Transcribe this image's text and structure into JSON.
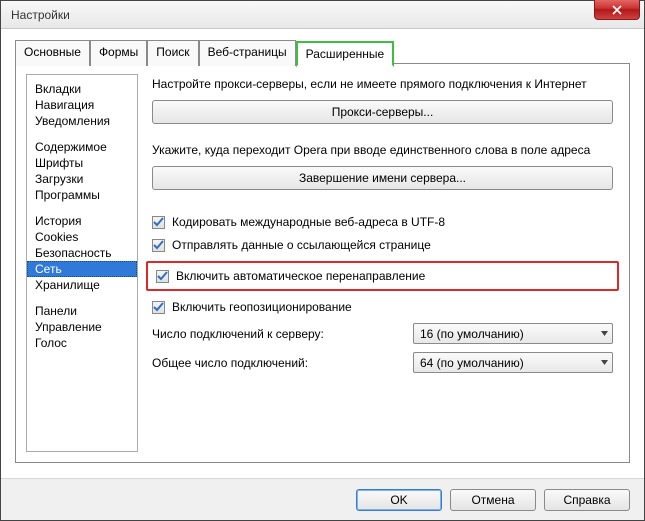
{
  "window": {
    "title": "Настройки"
  },
  "tabs": [
    "Основные",
    "Формы",
    "Поиск",
    "Веб-страницы",
    "Расширенные"
  ],
  "activeTabIndex": 4,
  "sidebar": {
    "groups": [
      [
        "Вкладки",
        "Навигация",
        "Уведомления"
      ],
      [
        "Содержимое",
        "Шрифты",
        "Загрузки",
        "Программы"
      ],
      [
        "История",
        "Cookies",
        "Безопасность",
        "Сеть",
        "Хранилище"
      ],
      [
        "Панели",
        "Управление",
        "Голос"
      ]
    ],
    "selected": "Сеть"
  },
  "main": {
    "proxy_text": "Настройте прокси-серверы, если не имеете прямого подключения к Интернет",
    "proxy_btn": "Прокси-серверы...",
    "single_word_text": "Укажите, куда переходит Opera при вводе единственного слова в поле адреса",
    "server_name_btn": "Завершение имени сервера...",
    "chk_utf8": "Кодировать международные веб-адреса в UTF-8",
    "chk_referrer": "Отправлять данные о ссылающейся странице",
    "chk_redirect": "Включить автоматическое перенаправление",
    "chk_geo": "Включить геопозиционирование",
    "conn_server_label": "Число подключений к серверу:",
    "conn_server_value": "16 (по умолчанию)",
    "conn_total_label": "Общее число подключений:",
    "conn_total_value": "64 (по умолчанию)"
  },
  "footer": {
    "ok": "OK",
    "cancel": "Отмена",
    "help": "Справка"
  }
}
